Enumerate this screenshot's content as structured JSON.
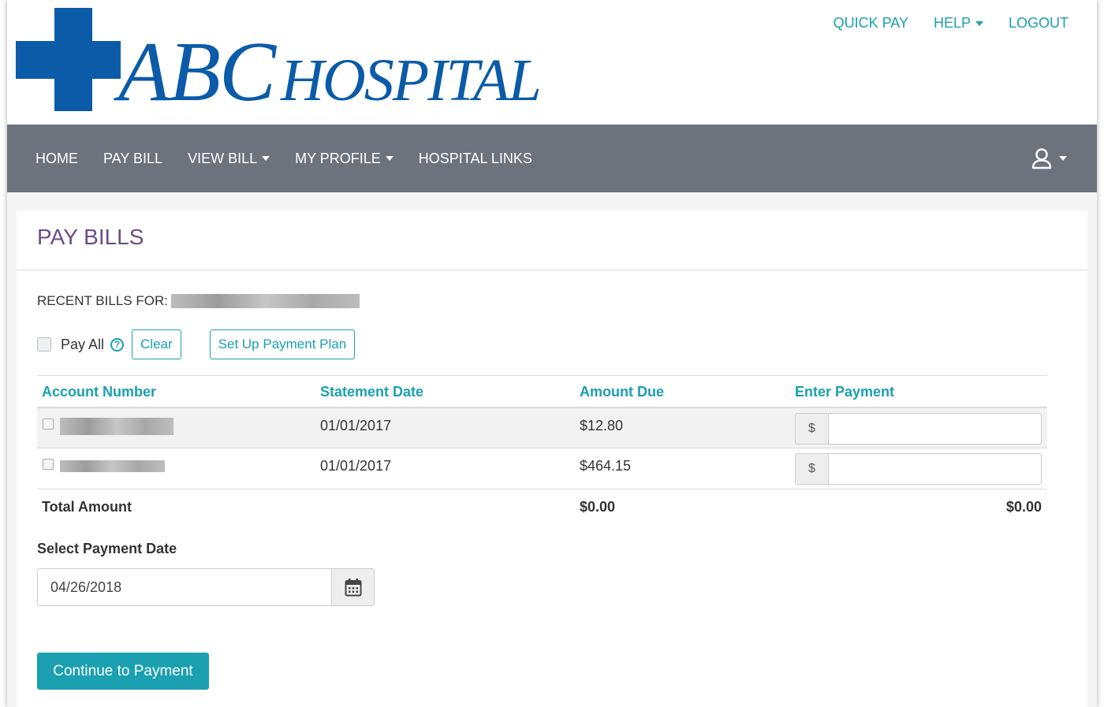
{
  "logo": {
    "brand_word": "ABC",
    "brand_sub": "HOSPITAL"
  },
  "top_links": [
    {
      "label": "QUICK PAY"
    },
    {
      "label": "HELP",
      "dropdown": true
    },
    {
      "label": "LOGOUT"
    }
  ],
  "nav": {
    "items": [
      {
        "label": "HOME"
      },
      {
        "label": "PAY BILL"
      },
      {
        "label": "VIEW BILL",
        "dropdown": true
      },
      {
        "label": "MY PROFILE",
        "dropdown": true
      },
      {
        "label": "HOSPITAL LINKS"
      }
    ],
    "user_icon": "user-icon"
  },
  "page": {
    "title": "PAY BILLS",
    "recent_bills_label": "RECENT BILLS FOR:",
    "pay_all_label": "Pay All",
    "help_icon": "question-circle-icon",
    "clear_label": "Clear",
    "payment_plan_label": "Set Up Payment Plan"
  },
  "table": {
    "columns": [
      "Account Number",
      "Statement Date",
      "Amount Due",
      "Enter Payment"
    ],
    "rows": [
      {
        "statement_date": "01/01/2017",
        "amount_due": "$12.80",
        "currency_symbol": "$",
        "payment_value": ""
      },
      {
        "statement_date": "01/01/2017",
        "amount_due": "$464.15",
        "currency_symbol": "$",
        "payment_value": ""
      }
    ],
    "total_label": "Total Amount",
    "total_amount_due": "$0.00",
    "total_payment": "$0.00"
  },
  "payment_date": {
    "label": "Select Payment Date",
    "value": "04/26/2018",
    "calendar_icon": "calendar-icon"
  },
  "continue_label": "Continue to Payment",
  "colors": {
    "brand_blue": "#0b5ba8",
    "accent_teal": "#1aa0b0",
    "nav_gray": "#6c737c",
    "title_purple": "#6b4c8a"
  }
}
